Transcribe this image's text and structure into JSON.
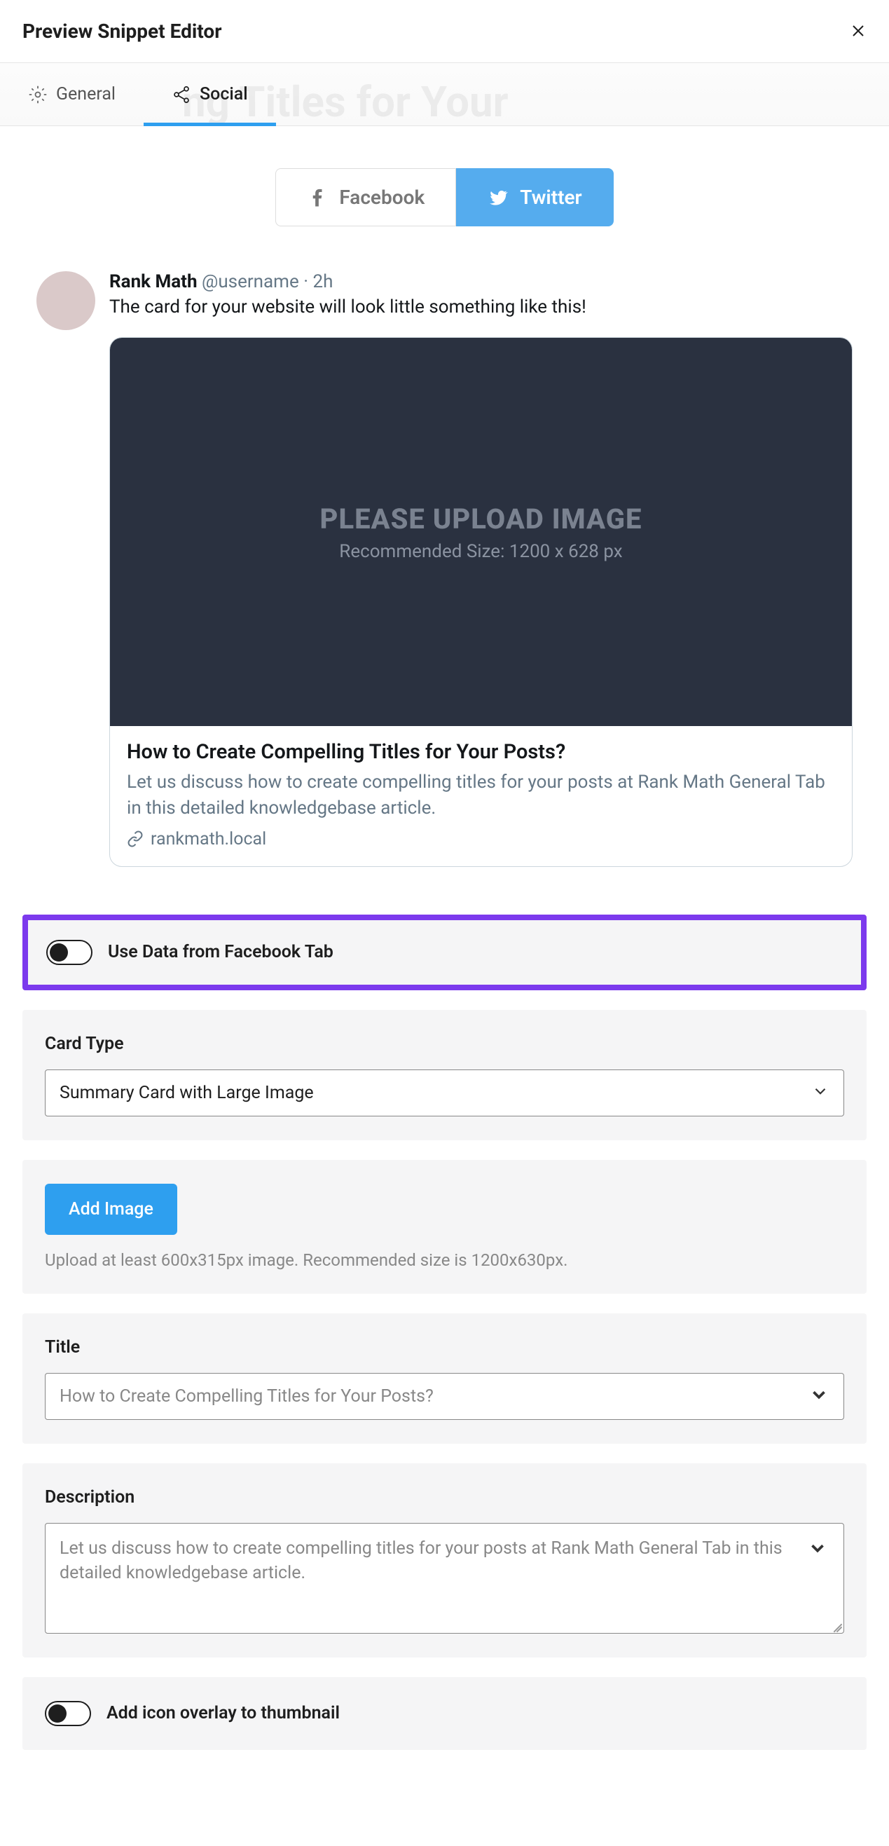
{
  "header": {
    "title": "Preview Snippet Editor",
    "ghost_title": "ng Titles for Your"
  },
  "tabs": {
    "general": "General",
    "social": "Social"
  },
  "social_tabs": {
    "facebook": "Facebook",
    "twitter": "Twitter"
  },
  "tweet": {
    "name": "Rank Math",
    "handle": "@username",
    "time": "2h",
    "text": "The card for your website will look little something like this!",
    "placeholder_line1": "PLEASE UPLOAD IMAGE",
    "placeholder_line2": "Recommended Size: 1200 x 628 px",
    "card_title": "How to Create Compelling Titles for Your Posts?",
    "card_desc": "Let us discuss how to create compelling titles for your posts at Rank Math General Tab in this detailed knowledgebase article.",
    "card_domain": "rankmath.local"
  },
  "toggles": {
    "use_fb_data_label": "Use Data from Facebook Tab",
    "icon_overlay_label": "Add icon overlay to thumbnail"
  },
  "card_type": {
    "label": "Card Type",
    "selected": "Summary Card with Large Image"
  },
  "image": {
    "button": "Add Image",
    "help": "Upload at least 600x315px image. Recommended size is 1200x630px."
  },
  "title_field": {
    "label": "Title",
    "placeholder": "How to Create Compelling Titles for Your Posts?"
  },
  "desc_field": {
    "label": "Description",
    "placeholder": "Let us discuss how to create compelling titles for your posts at Rank Math General Tab in this detailed knowledgebase article."
  }
}
